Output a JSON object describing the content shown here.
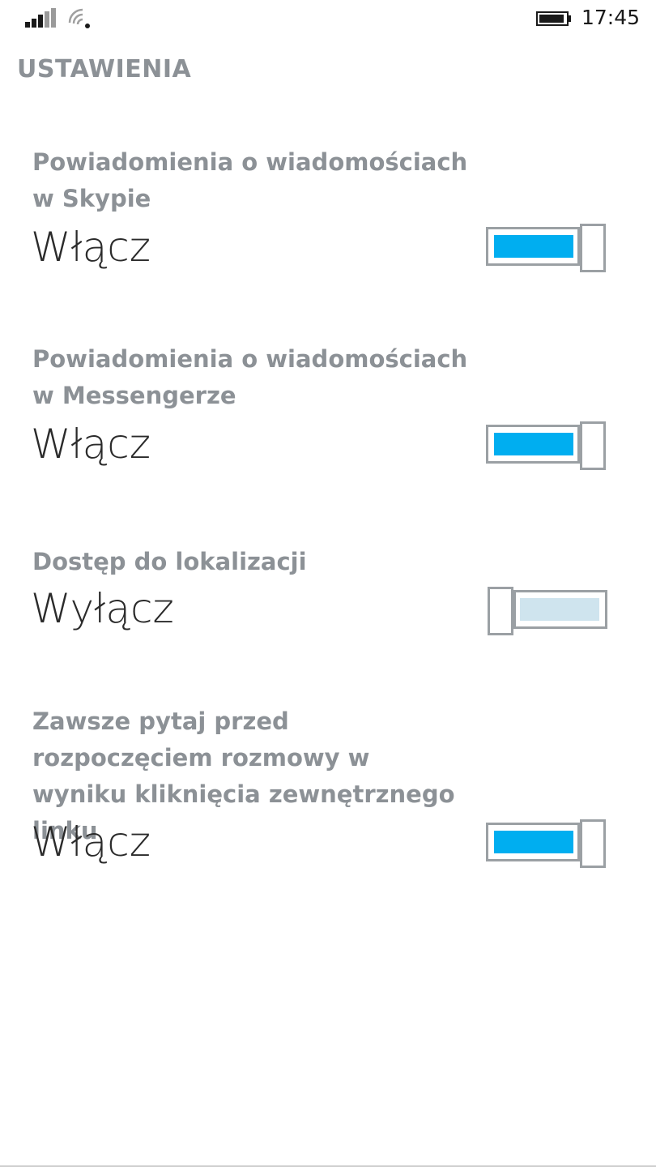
{
  "status_bar": {
    "time": "17:45",
    "signal_icon": "signal-bars-icon",
    "wifi_icon": "wifi-icon",
    "battery_icon": "battery-icon"
  },
  "page": {
    "title": "USTAWIENIA"
  },
  "settings": [
    {
      "label": "Powiadomienia o wiadomościach w Skypie",
      "value": "Włącz",
      "on": true
    },
    {
      "label": "Powiadomienia o wiadomościach w Messengerze",
      "value": "Włącz",
      "on": true
    },
    {
      "label": "Dostęp do lokalizacji",
      "value": "Wyłącz",
      "on": false
    },
    {
      "label": "Zawsze pytaj przed rozpoczęciem rozmowy w wyniku kliknięcia zewnętrznego linku",
      "value": "Włącz",
      "on": true
    }
  ],
  "colors": {
    "accent": "#00aef0",
    "off_fill": "#cfe4ee",
    "label": "#8c9196",
    "value": "#2b2b2b"
  }
}
